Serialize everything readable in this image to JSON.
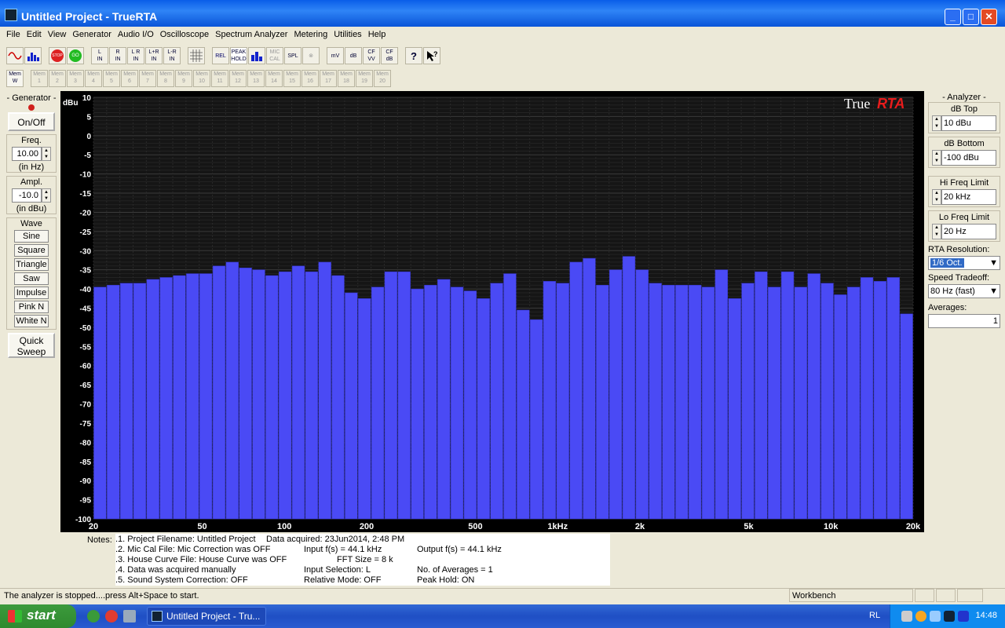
{
  "window": {
    "title": "Untitled Project - TrueRTA"
  },
  "menu": [
    "File",
    "Edit",
    "View",
    "Generator",
    "Audio I/O",
    "Oscilloscope",
    "Spectrum Analyzer",
    "Metering",
    "Utilities",
    "Help"
  ],
  "toolbar": {
    "buttons": [
      "L\nIN",
      "R\nIN",
      "L R\nIN",
      "L+R\nIN",
      "L-R\nIN",
      "REL",
      "PEAK\nHOLD",
      "MIC\nCAL",
      "SPL",
      "mV",
      "dB",
      "CF\nVV",
      "CF\ndB",
      "?"
    ],
    "stop_label": "STOP",
    "go_label": "GO"
  },
  "memory": {
    "label_top": "Mem",
    "w_label": "W",
    "slots": [
      "1",
      "2",
      "3",
      "4",
      "5",
      "6",
      "7",
      "8",
      "9",
      "10",
      "11",
      "12",
      "13",
      "14",
      "15",
      "16",
      "17",
      "18",
      "19",
      "20"
    ]
  },
  "generator": {
    "title": "- Generator -",
    "onoff": "On/Off",
    "freq_label": "Freq.",
    "freq_value": "10.00",
    "freq_unit": "(in Hz)",
    "ampl_label": "Ampl.",
    "ampl_value": "-10.0",
    "ampl_unit": "(in dBu)",
    "wave_label": "Wave",
    "waves": [
      "Sine",
      "Square",
      "Triangle",
      "Saw",
      "Impulse",
      "Pink N",
      "White N"
    ],
    "quick_sweep": "Quick Sweep",
    "status_color": "#d0201c"
  },
  "analyzer": {
    "title": "- Analyzer -",
    "db_top_label": "dB Top",
    "db_top_value": "10 dBu",
    "db_bottom_label": "dB Bottom",
    "db_bottom_value": "-100 dBu",
    "hi_freq_label": "Hi Freq Limit",
    "hi_freq_value": "20 kHz",
    "lo_freq_label": "Lo Freq Limit",
    "lo_freq_value": "20 Hz",
    "rta_res_label": "RTA Resolution:",
    "rta_res_value": "1/6 Oct.",
    "speed_label": "Speed Tradeoff:",
    "speed_value": "80 Hz (fast)",
    "averages_label": "Averages:",
    "averages_value": "1"
  },
  "chart_data": {
    "type": "bar",
    "logo_text": "True",
    "logo_accent": "RTA",
    "ylabel": "dBu",
    "ylim": [
      -100,
      10
    ],
    "yticks": [
      10,
      5,
      0,
      -5,
      -10,
      -15,
      -20,
      -25,
      -30,
      -35,
      -40,
      -45,
      -50,
      -55,
      -60,
      -65,
      -70,
      -75,
      -80,
      -85,
      -90,
      -95,
      -100
    ],
    "xlim_hz": [
      20,
      20000
    ],
    "x_scale": "log",
    "xtick_values": [
      20,
      50,
      100,
      200,
      500,
      1000,
      2000,
      5000,
      10000,
      20000
    ],
    "xtick_labels": [
      "20",
      "50",
      "100",
      "200",
      "500",
      "1kHz",
      "2k",
      "5k",
      "10k",
      "20k"
    ],
    "bar_color": "#4a4af5",
    "grid": true,
    "band_count": 60,
    "values": [
      -39.5,
      -39,
      -38.5,
      -38.5,
      -37.5,
      -37,
      -36.5,
      -36,
      -36,
      -34,
      -33,
      -34.5,
      -35,
      -36.5,
      -35.5,
      -34,
      -35.5,
      -33,
      -36.5,
      -41,
      -42.5,
      -39.5,
      -35.5,
      -35.5,
      -40,
      -39,
      -37.5,
      -39.5,
      -40.5,
      -42.5,
      -38.5,
      -36,
      -45.5,
      -48,
      -38,
      -38.5,
      -33,
      -32,
      -39,
      -35,
      -31.5,
      -35,
      -38.5,
      -39,
      -39,
      -39,
      -39.5,
      -35,
      -42.5,
      -38.5,
      -35.5,
      -39.5,
      -35.5,
      -39.5,
      -36,
      -38.5,
      -41.5,
      -39.5,
      -37,
      -38,
      -37,
      -46.5
    ]
  },
  "notes": {
    "label": "Notes:",
    "col1": [
      ".1. Project Filename: Untitled Project",
      ".2. Mic Cal File: Mic Correction was OFF",
      ".3. House Curve File: House Curve was OFF",
      ".4. Data was acquired manually",
      ".5. Sound System Correction: OFF"
    ],
    "acquired": "Data acquired: 23Jun2014, 2:48 PM",
    "col2": [
      "Input f(s) = 44.1 kHz",
      "FFT Size = 8 k",
      "Input Selection: L",
      "Relative Mode:  OFF"
    ],
    "col3": [
      "Output f(s) = 44.1 kHz",
      "No. of Averages = 1",
      "Peak Hold: ON"
    ]
  },
  "status": {
    "message": "The analyzer is stopped....press Alt+Space to start.",
    "workbench": "Workbench"
  },
  "taskbar": {
    "start": "start",
    "task_title": "Untitled Project - Tru...",
    "lang": "RL",
    "clock": "14:48"
  }
}
